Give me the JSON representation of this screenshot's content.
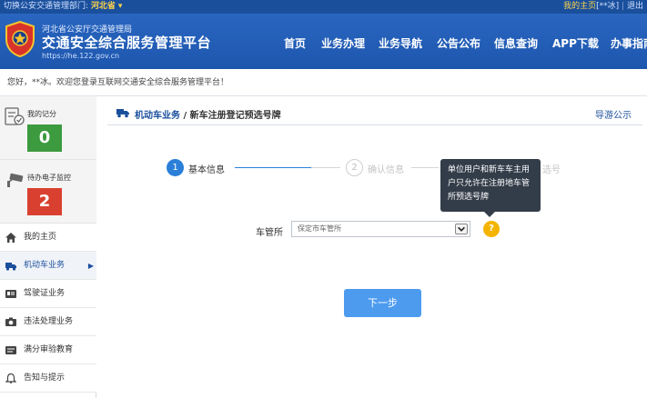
{
  "topbar": {
    "switch_label": "切换公安交通管理部门:",
    "province": "河北省",
    "home_link": "我的主页",
    "user": "[**冰]",
    "logout": "退出"
  },
  "header": {
    "org_name": "河北省公安厅交通管理局",
    "platform_title": "交通安全综合服务管理平台",
    "url": "https://he.122.gov.cn",
    "nav": [
      "首页",
      "业务办理",
      "业务导航",
      "公告公布",
      "信息查询",
      "APP下载",
      "办事指南"
    ]
  },
  "welcome": "您好，**冰。欢迎您登录互联网交通安全综合服务管理平台！",
  "sidebar": {
    "score_label": "我的记分",
    "score_value": "0",
    "monitor_label": "待办电子监控",
    "monitor_value": "2",
    "items": [
      {
        "label": "我的主页",
        "icon": "home-icon"
      },
      {
        "label": "机动车业务",
        "icon": "truck-icon",
        "active": true
      },
      {
        "label": "驾驶证业务",
        "icon": "license-icon"
      },
      {
        "label": "违法处理业务",
        "icon": "camera-icon"
      },
      {
        "label": "满分审验教育",
        "icon": "education-icon"
      },
      {
        "label": "告知与提示",
        "icon": "bell-icon"
      }
    ]
  },
  "main": {
    "breadcrumb_section": "机动车业务",
    "breadcrumb_separator": " / ",
    "breadcrumb_page": "新车注册登记预选号牌",
    "guide_link": "导游公示",
    "steps": [
      {
        "num": "1",
        "label": "基本信息",
        "state": "active"
      },
      {
        "num": "2",
        "label": "确认信息",
        "state": "inactive"
      },
      {
        "num": "",
        "label": "选号",
        "state": "inactive"
      }
    ],
    "tooltip_text": "单位用户和新车车主用户只允许在注册地车管所预选号牌",
    "field_label": "车管所",
    "select_value": "保定市车管所",
    "help_symbol": "?",
    "next_button": "下一步"
  },
  "colors": {
    "header_blue": "#1d56ad",
    "topbar_blue": "#1a4f9c",
    "accent_blue": "#2b7fd8",
    "score_green": "#3c9a3f",
    "alert_red": "#d9402f",
    "help_yellow": "#f4b400",
    "button_blue": "#4d9bef"
  }
}
